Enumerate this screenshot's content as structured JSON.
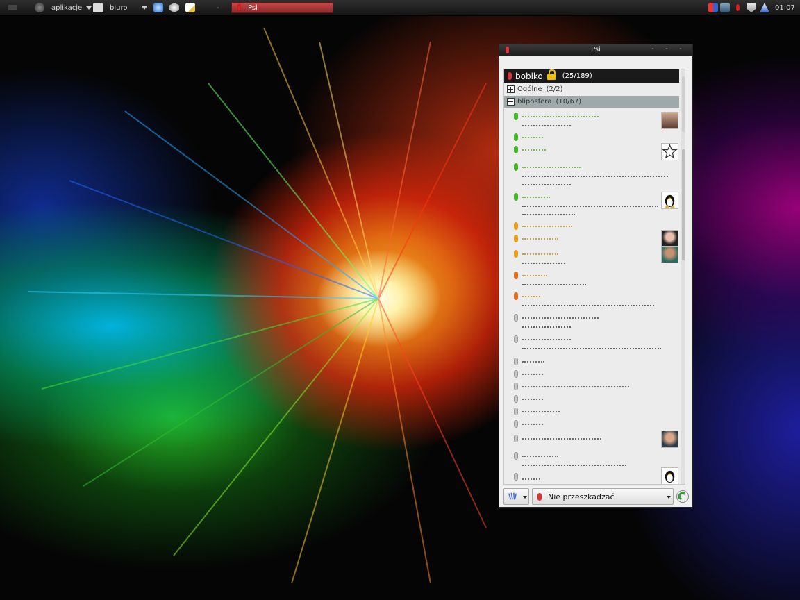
{
  "panel": {
    "menu_apps": "aplikacje",
    "menu_office": "biuro",
    "task_psi": "Psi",
    "clock": "01:07"
  },
  "window": {
    "title": "Psi"
  },
  "account": {
    "name": "bobiko",
    "count": "(25/189)"
  },
  "groups": [
    {
      "name": "Ogólne",
      "count": "(2/2)",
      "expanded": false
    },
    {
      "name": "bliposfera",
      "count": "(10/67)",
      "expanded": true
    }
  ],
  "status": {
    "label": "Nie przeszkadzać"
  },
  "colors": {
    "online": "#46b82a",
    "away": "#e8a020",
    "dnd": "#e07020",
    "offline": "#c8c8c8",
    "group_bg": "#9fa9a9"
  },
  "icons": {
    "lock": "lock-icon",
    "psi_menu": "psi-logo-icon",
    "connect": "connection-icon"
  }
}
